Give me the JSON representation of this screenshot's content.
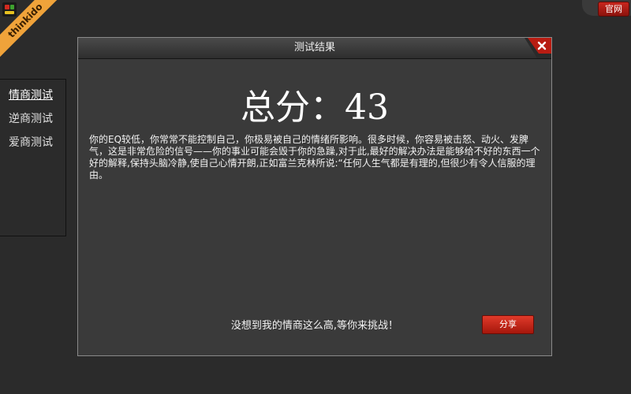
{
  "brand": {
    "ribbon_text": "thinkido",
    "icon": "app-logo-icon"
  },
  "header_right": {
    "official_label": "官网"
  },
  "sidebar": {
    "items": [
      {
        "label": "情商测试",
        "active": true
      },
      {
        "label": "逆商测试",
        "active": false
      },
      {
        "label": "爱商测试",
        "active": false
      }
    ]
  },
  "dialog": {
    "title": "测试结果",
    "close_icon": "close-icon",
    "score_text": "总分：43",
    "description": "你的EQ较低，你常常不能控制自己，你极易被自己的情绪所影响。很多时候，你容易被击怒、动火、发脾气，这是非常危险的信号——你的事业可能会毁于你的急躁,对于此,最好的解决办法是能够给不好的东西一个好的解释,保持头脑冷静,使自己心情开朗,正如富兰克林所说:“任何人生气都是有理的,但很少有令人信服的理由。",
    "share_message": "没想到我的情商这么高,等你来挑战！",
    "share_label": "分享"
  },
  "colors": {
    "background": "#2b2b2b",
    "dialog_bg": "#3a3a3a",
    "accent_red": "#c8261d",
    "ribbon_orange": "#f0a33a"
  }
}
